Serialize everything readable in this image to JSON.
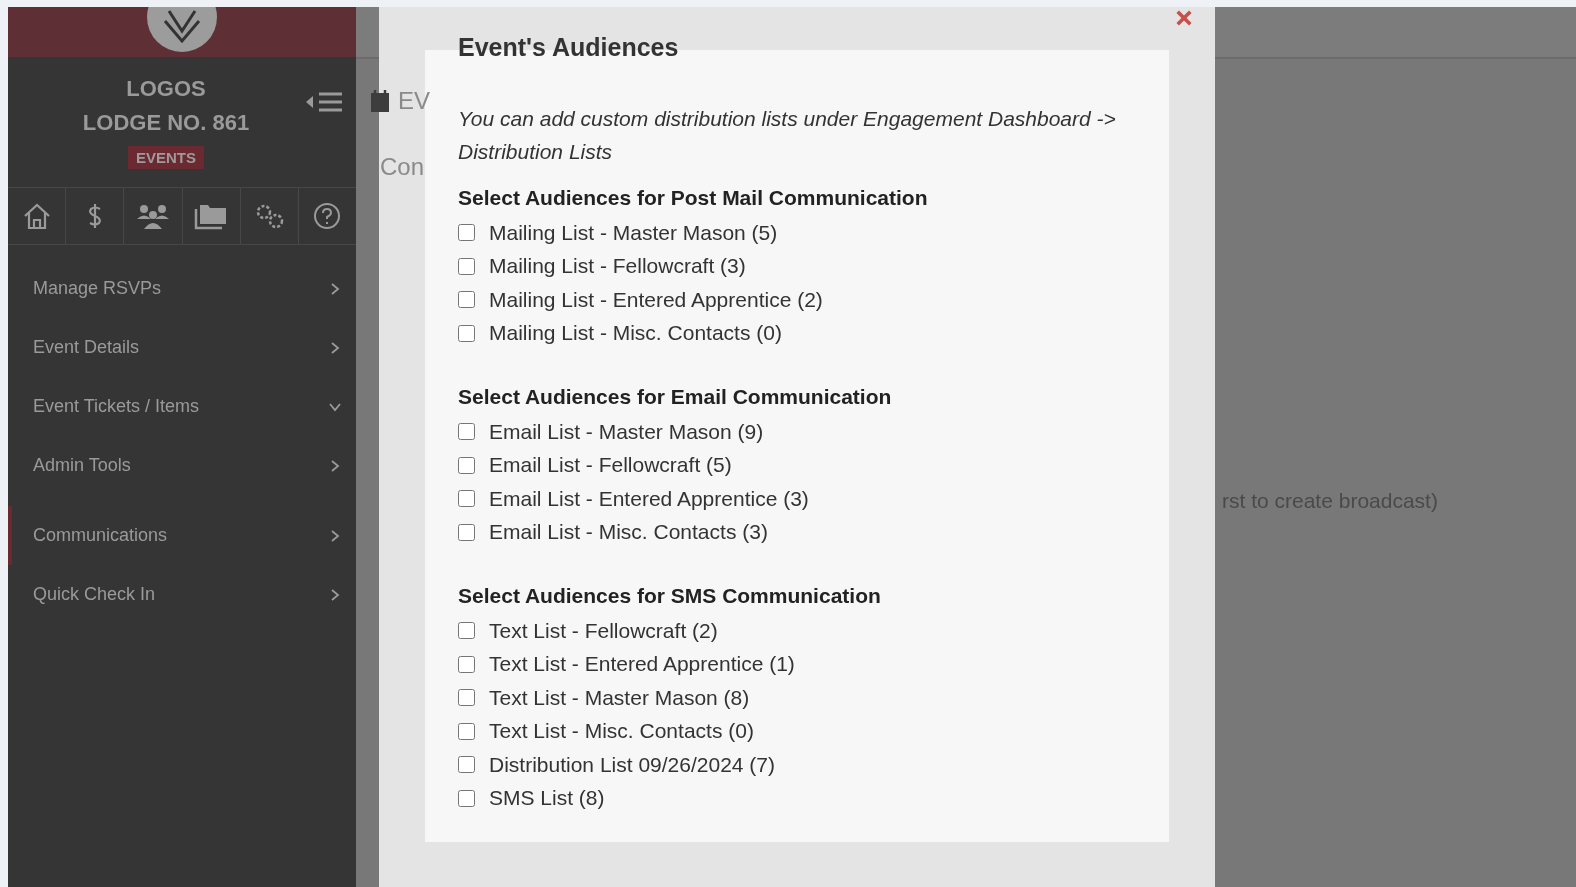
{
  "sidebar": {
    "lodge_name": [
      "LOGOS",
      "LODGE NO. 861"
    ],
    "section_badge": "EVENTS",
    "menu": [
      {
        "label": "Manage RSVPs",
        "selected": false,
        "expanded": false
      },
      {
        "label": "Event Details",
        "selected": false,
        "expanded": false
      },
      {
        "label": "Event Tickets / Items",
        "selected": false,
        "expanded": true
      },
      {
        "label": "Admin Tools",
        "selected": false,
        "expanded": false
      },
      {
        "label": "Communications",
        "selected": true,
        "expanded": false
      },
      {
        "label": "Quick Check In",
        "selected": false,
        "expanded": false
      }
    ]
  },
  "background": {
    "page_heading": "EV",
    "section_label": "Con",
    "hint": "rst to create broadcast)"
  },
  "modal": {
    "title": "Event's Audiences",
    "note": "You can add custom distribution lists under Engagement Dashboard -> Distribution Lists",
    "groups": [
      {
        "heading": "Select Audiences for Post Mail Communication",
        "options": [
          {
            "label": "Mailing List - Master Mason (5)",
            "checked": false
          },
          {
            "label": "Mailing List - Fellowcraft (3)",
            "checked": false
          },
          {
            "label": "Mailing List - Entered Apprentice (2)",
            "checked": false
          },
          {
            "label": "Mailing List - Misc. Contacts (0)",
            "checked": false
          }
        ]
      },
      {
        "heading": "Select Audiences for Email Communication",
        "options": [
          {
            "label": "Email List - Master Mason (9)",
            "checked": false
          },
          {
            "label": "Email List - Fellowcraft (5)",
            "checked": false
          },
          {
            "label": "Email List - Entered Apprentice (3)",
            "checked": false
          },
          {
            "label": "Email List - Misc. Contacts (3)",
            "checked": false
          }
        ]
      },
      {
        "heading": "Select Audiences for SMS Communication",
        "options": [
          {
            "label": "Text List - Fellowcraft (2)",
            "checked": false
          },
          {
            "label": "Text List - Entered Apprentice (1)",
            "checked": false
          },
          {
            "label": "Text List - Master Mason (8)",
            "checked": false
          },
          {
            "label": "Text List - Misc. Contacts (0)",
            "checked": false
          },
          {
            "label": "Distribution List 09/26/2024 (7)",
            "checked": false
          },
          {
            "label": "SMS List (8)",
            "checked": false
          }
        ]
      }
    ]
  }
}
